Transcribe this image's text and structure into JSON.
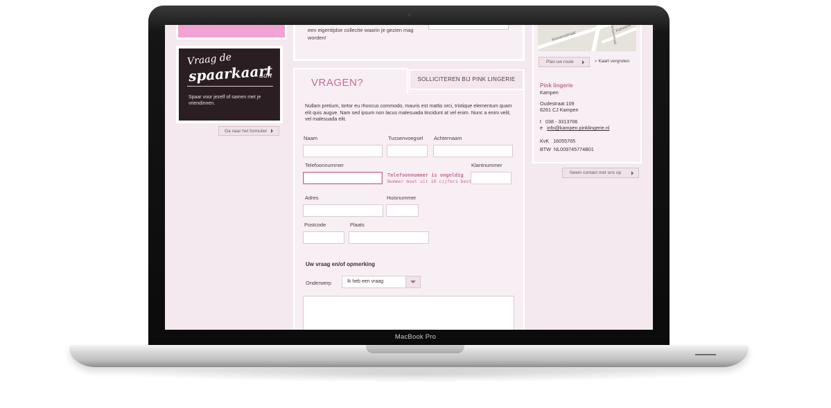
{
  "device": {
    "label": "MacBook Pro"
  },
  "sidebar_left": {
    "card": {
      "script_line1": "Vraag de",
      "script_line2": "spaarkaart",
      "script_line3": "aan",
      "text": "Spaar voor jezelf of samen met je vriendinnen."
    },
    "form_link": "Ga naar het formulier"
  },
  "top_panel": {
    "text": "een eigentijdse collectie waarin je gezien mag worden!"
  },
  "tabs": [
    {
      "label": "VRAGEN?",
      "active": true
    },
    {
      "label": "SOLLICITEREN BIJ PINK LINGERIE",
      "active": false
    }
  ],
  "form": {
    "intro": "Nullam pretium, tortor eu rhoncus commodo, mauris est mattis orci, tristique elementum quam elit quis augue. Nam sed ipsum non lacus malesuada tincidunt at vel enim. Nunc a enim velit, vel malesuada elit.",
    "labels": {
      "naam": "Naam",
      "tussenvoegsel": "Tussenvoegsel",
      "achternaam": "Achternaam",
      "telefoon": "Telefoonnummer",
      "klantnummer": "Klantnummer",
      "adres": "Adres",
      "huisnummer": "Huisnummer",
      "postcode": "Postcode",
      "plaats": "Plaats"
    },
    "error": {
      "title": "Telefoonnummer is ongeldig",
      "message": "Nummer moet uit 10 cijfers bestaan."
    },
    "section_title": "Uw vraag en/of opmerking",
    "subject_label": "Onderwerp",
    "subject_selected": "Ik heb een vraag"
  },
  "map": {
    "street1": "Kinnersstraat",
    "street2": "Kanzerw",
    "street3": "Kamperstraat",
    "route_button": "Plan uw route",
    "zoom_link": "Kaart vergroten"
  },
  "business": {
    "name": "Pink lingerie",
    "city": "Kampen",
    "street": "Oudestraat 109",
    "postal": "8261 CJ Kampen",
    "phone_prefix": "t",
    "phone": "038 - 3313706",
    "email_prefix": "e",
    "email": "info@kampen.pinklingerie.nl",
    "kvk_label": "KvK",
    "kvk": "16055765",
    "btw_label": "BTW",
    "btw": "NL009745774B01",
    "contact_button": "Neem contact met ons op"
  },
  "colors": {
    "accent": "#c56a96",
    "card_bg": "#2b1e22",
    "panel_bg": "#f8eff4",
    "promo_pink": "#f1a3d4"
  }
}
